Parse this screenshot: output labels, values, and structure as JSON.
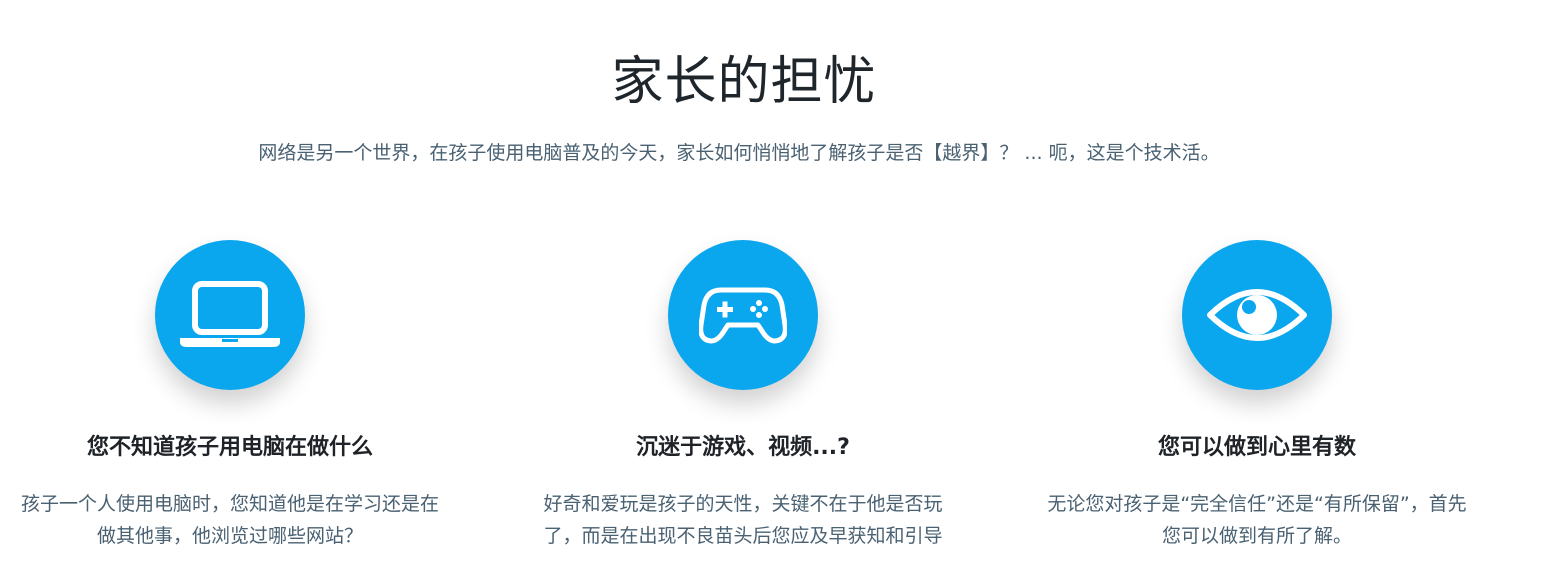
{
  "section": {
    "title": "家长的担忧",
    "subtitle": "网络是另一个世界，在孩子使用电脑普及的今天，家长如何悄悄地了解孩子是否【越界】？ ... 呃，这是个技术活。"
  },
  "features": [
    {
      "icon": "laptop-icon",
      "title": "您不知道孩子用电脑在做什么",
      "desc": "孩子一个人使用电脑时，您知道他是在学习还是在做其他事，他浏览过哪些网站？"
    },
    {
      "icon": "gamepad-icon",
      "title": "沉迷于游戏、视频...?",
      "desc": "好奇和爱玩是孩子的天性，关键不在于他是否玩了，而是在出现不良苗头后您应及早获知和引导"
    },
    {
      "icon": "eye-icon",
      "title": "您可以做到心里有数",
      "desc": "无论您对孩子是“完全信任”还是“有所保留”，首先您可以做到有所了解。"
    }
  ],
  "colors": {
    "accent": "#0aa6ee",
    "heading": "#1e252b",
    "body_text": "#4a6172"
  }
}
